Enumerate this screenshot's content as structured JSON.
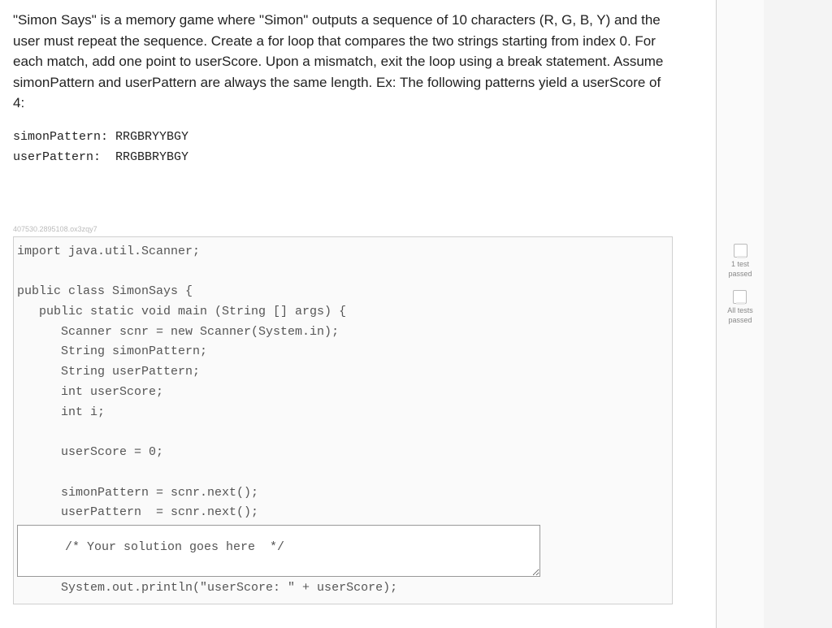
{
  "problem": {
    "description": "\"Simon Says\" is a memory game where \"Simon\" outputs a sequence of 10 characters (R, G, B, Y) and the user must repeat the sequence. Create a for loop that compares the two strings starting from index 0. For each match, add one point to userScore. Upon a mismatch, exit the loop using a break statement. Assume simonPattern and userPattern are always the same length. Ex: The following patterns yield a userScore of 4:",
    "patterns": "simonPattern: RRGBRYYBGY\nuserPattern:  RRGBBRYBGY"
  },
  "watermark": "407530.2895108.ox3zqy7",
  "code": {
    "before": "import java.util.Scanner;\n\npublic class SimonSays {\n   public static void main (String [] args) {\n      Scanner scnr = new Scanner(System.in);\n      String simonPattern;\n      String userPattern;\n      int userScore;\n      int i;\n\n      userScore = 0;\n\n      simonPattern = scnr.next();\n      userPattern  = scnr.next();",
    "solution_placeholder": "      /* Your solution goes here  */",
    "after": "      System.out.println(\"userScore: \" + userScore);"
  },
  "tests": {
    "one_test": "1 test\npassed",
    "all_tests": "All tests\npassed"
  }
}
